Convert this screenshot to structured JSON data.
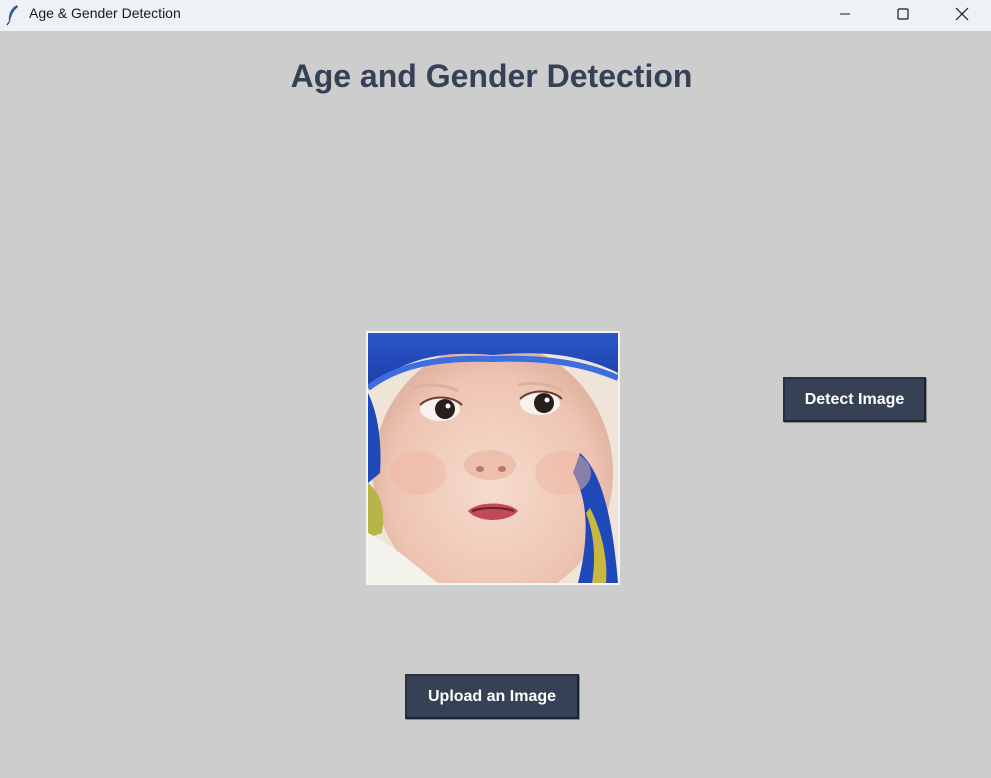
{
  "window": {
    "title": "Age & Gender Detection",
    "controls": {
      "minimize": "minimize-icon",
      "maximize": "maximize-icon",
      "close": "close-icon"
    },
    "app_icon": "feather-icon"
  },
  "main": {
    "heading": "Age and Gender Detection",
    "image_preview": {
      "subject": "photo of a baby wearing a blue hat"
    },
    "detect_button": "Detect Image",
    "upload_button": "Upload an Image"
  },
  "colors": {
    "background": "#cdcdcd",
    "heading": "#364156",
    "button_bg": "#364156",
    "button_text": "#ffffff",
    "titlebar": "#eef2f6"
  }
}
